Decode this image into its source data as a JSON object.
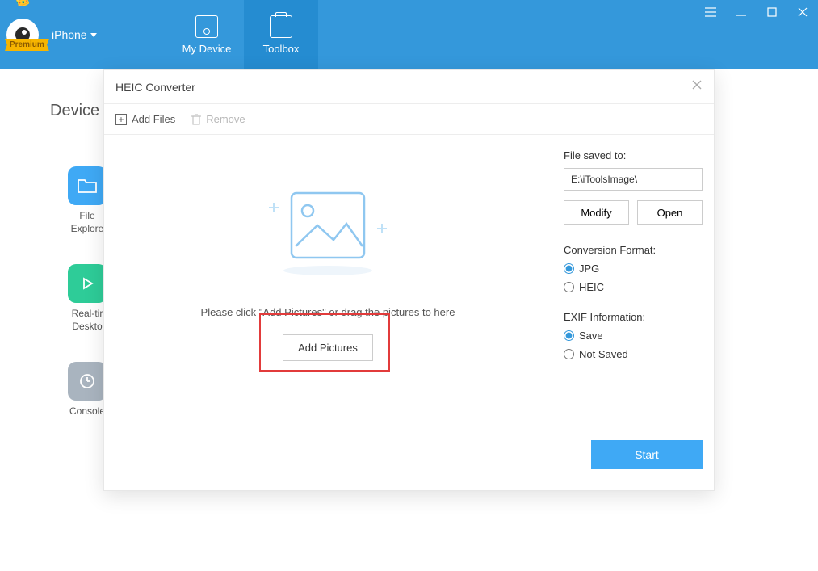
{
  "header": {
    "device_label": "iPhone",
    "premium_badge": "Premium",
    "tabs": {
      "my_device": "My Device",
      "toolbox": "Toolbox"
    }
  },
  "content": {
    "device_heading": "Device"
  },
  "sidebar": {
    "file_explorer": "File\nExplore",
    "realtime_desktop": "Real-tir\nDeskto",
    "console": "Console"
  },
  "modal": {
    "title": "HEIC Converter",
    "toolbar": {
      "add_files": "Add Files",
      "remove": "Remove"
    },
    "drop": {
      "hint": "Please click \"Add Pictures\" or drag the pictures to here",
      "button": "Add Pictures"
    },
    "panel": {
      "file_saved_label": "File saved to:",
      "file_saved_path": "E:\\iToolsImage\\",
      "modify": "Modify",
      "open": "Open",
      "format_label": "Conversion Format:",
      "format_jpg": "JPG",
      "format_heic": "HEIC",
      "exif_label": "EXIF Information:",
      "exif_save": "Save",
      "exif_not_saved": "Not Saved",
      "start": "Start"
    }
  }
}
